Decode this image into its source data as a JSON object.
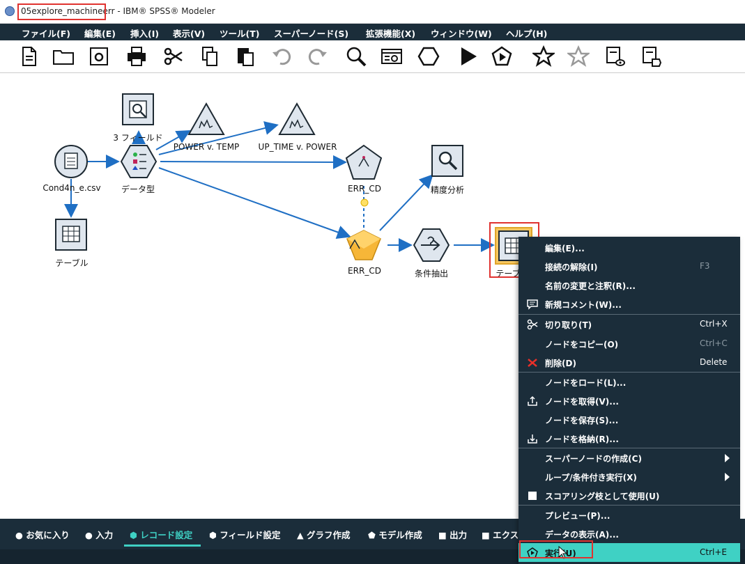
{
  "window": {
    "title_file": "05explore_machineerr",
    "title_rest": " - IBM® SPSS® Modeler"
  },
  "menubar": {
    "items": [
      "ファイル(F)",
      "編集(E)",
      "挿入(I)",
      "表示(V)",
      "ツール(T)",
      "スーパーノード(S)",
      "拡張機能(X)",
      "ウィンドウ(W)",
      "ヘルプ(H)"
    ]
  },
  "toolbar": {
    "icons": [
      "new-stream-icon",
      "open-folder-icon",
      "save-icon",
      "print-icon",
      "cut-icon",
      "copy-icon",
      "paste-icon",
      "undo-icon",
      "redo-icon",
      "zoom-icon",
      "stream-properties-icon",
      "supernode-icon",
      "run-icon",
      "run-selection-icon",
      "favorites-star-icon",
      "star-outline-icon",
      "preview-icon",
      "annotate-icon"
    ]
  },
  "canvas": {
    "nodes": {
      "source": "Cond4n_e.csv",
      "table1": "テーブル",
      "filter3": "3 フィールド",
      "type": "データ型",
      "plot1": "POWER v. TEMP",
      "plot2": "UP_TIME v. POWER",
      "chaid_model": "ERR_CD",
      "analysis": "精度分析",
      "chaid_nugget": "ERR_CD",
      "select": "条件抽出",
      "table2": "テーブ"
    }
  },
  "palette": {
    "tabs": [
      "お気に入り",
      "入力",
      "レコード設定",
      "フィールド設定",
      "グラフ作成",
      "モデル作成",
      "出力",
      "エクス"
    ]
  },
  "context_menu": {
    "items": [
      {
        "label": "編集(E)...",
        "shortcut": ""
      },
      {
        "label": "接続の解除(I)",
        "shortcut": "F3"
      },
      {
        "label": "名前の変更と注釈(R)...",
        "shortcut": ""
      },
      {
        "label": "新規コメント(W)...",
        "shortcut": ""
      },
      {
        "label": "切り取り(T)",
        "shortcut": "Ctrl+X"
      },
      {
        "label": "ノードをコピー(O)",
        "shortcut": "Ctrl+C"
      },
      {
        "label": "削除(D)",
        "shortcut": "Delete"
      },
      {
        "label": "ノードをロード(L)...",
        "shortcut": ""
      },
      {
        "label": "ノードを取得(V)...",
        "shortcut": ""
      },
      {
        "label": "ノードを保存(S)...",
        "shortcut": ""
      },
      {
        "label": "ノードを格納(R)...",
        "shortcut": ""
      },
      {
        "label": "スーパーノードの作成(C)",
        "shortcut": ""
      },
      {
        "label": "ループ/条件付き実行(X)",
        "shortcut": ""
      },
      {
        "label": "スコアリング枝として使用(U)",
        "shortcut": ""
      },
      {
        "label": "プレビュー(P)...",
        "shortcut": ""
      },
      {
        "label": "データの表示(A)...",
        "shortcut": ""
      },
      {
        "label": "実行(U)",
        "shortcut": "Ctrl+E"
      }
    ]
  },
  "colors": {
    "menubar": "#1b2d3a",
    "accent": "#3fd1c4",
    "edge": "#1f6fc4",
    "highlight": "#e0322f"
  }
}
